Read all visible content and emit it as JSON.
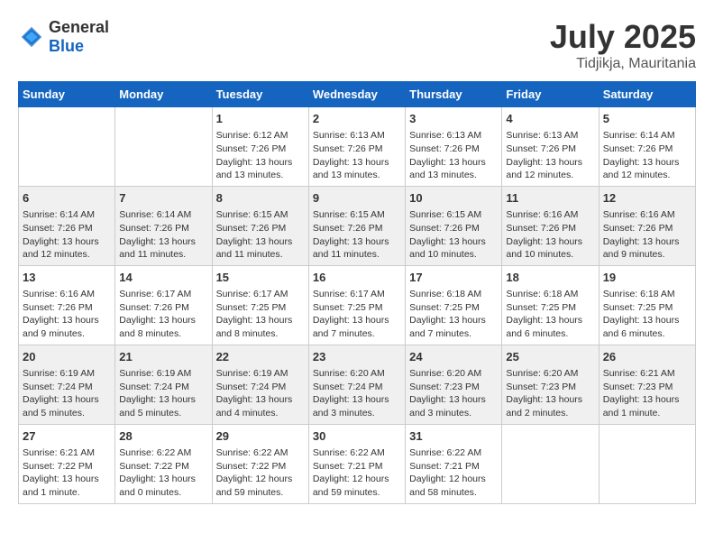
{
  "header": {
    "logo_general": "General",
    "logo_blue": "Blue",
    "month_year": "July 2025",
    "location": "Tidjikja, Mauritania"
  },
  "weekdays": [
    "Sunday",
    "Monday",
    "Tuesday",
    "Wednesday",
    "Thursday",
    "Friday",
    "Saturday"
  ],
  "weeks": [
    [
      {
        "day": "",
        "sunrise": "",
        "sunset": "",
        "daylight": ""
      },
      {
        "day": "",
        "sunrise": "",
        "sunset": "",
        "daylight": ""
      },
      {
        "day": "1",
        "sunrise": "Sunrise: 6:12 AM",
        "sunset": "Sunset: 7:26 PM",
        "daylight": "Daylight: 13 hours and 13 minutes."
      },
      {
        "day": "2",
        "sunrise": "Sunrise: 6:13 AM",
        "sunset": "Sunset: 7:26 PM",
        "daylight": "Daylight: 13 hours and 13 minutes."
      },
      {
        "day": "3",
        "sunrise": "Sunrise: 6:13 AM",
        "sunset": "Sunset: 7:26 PM",
        "daylight": "Daylight: 13 hours and 13 minutes."
      },
      {
        "day": "4",
        "sunrise": "Sunrise: 6:13 AM",
        "sunset": "Sunset: 7:26 PM",
        "daylight": "Daylight: 13 hours and 12 minutes."
      },
      {
        "day": "5",
        "sunrise": "Sunrise: 6:14 AM",
        "sunset": "Sunset: 7:26 PM",
        "daylight": "Daylight: 13 hours and 12 minutes."
      }
    ],
    [
      {
        "day": "6",
        "sunrise": "Sunrise: 6:14 AM",
        "sunset": "Sunset: 7:26 PM",
        "daylight": "Daylight: 13 hours and 12 minutes."
      },
      {
        "day": "7",
        "sunrise": "Sunrise: 6:14 AM",
        "sunset": "Sunset: 7:26 PM",
        "daylight": "Daylight: 13 hours and 11 minutes."
      },
      {
        "day": "8",
        "sunrise": "Sunrise: 6:15 AM",
        "sunset": "Sunset: 7:26 PM",
        "daylight": "Daylight: 13 hours and 11 minutes."
      },
      {
        "day": "9",
        "sunrise": "Sunrise: 6:15 AM",
        "sunset": "Sunset: 7:26 PM",
        "daylight": "Daylight: 13 hours and 11 minutes."
      },
      {
        "day": "10",
        "sunrise": "Sunrise: 6:15 AM",
        "sunset": "Sunset: 7:26 PM",
        "daylight": "Daylight: 13 hours and 10 minutes."
      },
      {
        "day": "11",
        "sunrise": "Sunrise: 6:16 AM",
        "sunset": "Sunset: 7:26 PM",
        "daylight": "Daylight: 13 hours and 10 minutes."
      },
      {
        "day": "12",
        "sunrise": "Sunrise: 6:16 AM",
        "sunset": "Sunset: 7:26 PM",
        "daylight": "Daylight: 13 hours and 9 minutes."
      }
    ],
    [
      {
        "day": "13",
        "sunrise": "Sunrise: 6:16 AM",
        "sunset": "Sunset: 7:26 PM",
        "daylight": "Daylight: 13 hours and 9 minutes."
      },
      {
        "day": "14",
        "sunrise": "Sunrise: 6:17 AM",
        "sunset": "Sunset: 7:26 PM",
        "daylight": "Daylight: 13 hours and 8 minutes."
      },
      {
        "day": "15",
        "sunrise": "Sunrise: 6:17 AM",
        "sunset": "Sunset: 7:25 PM",
        "daylight": "Daylight: 13 hours and 8 minutes."
      },
      {
        "day": "16",
        "sunrise": "Sunrise: 6:17 AM",
        "sunset": "Sunset: 7:25 PM",
        "daylight": "Daylight: 13 hours and 7 minutes."
      },
      {
        "day": "17",
        "sunrise": "Sunrise: 6:18 AM",
        "sunset": "Sunset: 7:25 PM",
        "daylight": "Daylight: 13 hours and 7 minutes."
      },
      {
        "day": "18",
        "sunrise": "Sunrise: 6:18 AM",
        "sunset": "Sunset: 7:25 PM",
        "daylight": "Daylight: 13 hours and 6 minutes."
      },
      {
        "day": "19",
        "sunrise": "Sunrise: 6:18 AM",
        "sunset": "Sunset: 7:25 PM",
        "daylight": "Daylight: 13 hours and 6 minutes."
      }
    ],
    [
      {
        "day": "20",
        "sunrise": "Sunrise: 6:19 AM",
        "sunset": "Sunset: 7:24 PM",
        "daylight": "Daylight: 13 hours and 5 minutes."
      },
      {
        "day": "21",
        "sunrise": "Sunrise: 6:19 AM",
        "sunset": "Sunset: 7:24 PM",
        "daylight": "Daylight: 13 hours and 5 minutes."
      },
      {
        "day": "22",
        "sunrise": "Sunrise: 6:19 AM",
        "sunset": "Sunset: 7:24 PM",
        "daylight": "Daylight: 13 hours and 4 minutes."
      },
      {
        "day": "23",
        "sunrise": "Sunrise: 6:20 AM",
        "sunset": "Sunset: 7:24 PM",
        "daylight": "Daylight: 13 hours and 3 minutes."
      },
      {
        "day": "24",
        "sunrise": "Sunrise: 6:20 AM",
        "sunset": "Sunset: 7:23 PM",
        "daylight": "Daylight: 13 hours and 3 minutes."
      },
      {
        "day": "25",
        "sunrise": "Sunrise: 6:20 AM",
        "sunset": "Sunset: 7:23 PM",
        "daylight": "Daylight: 13 hours and 2 minutes."
      },
      {
        "day": "26",
        "sunrise": "Sunrise: 6:21 AM",
        "sunset": "Sunset: 7:23 PM",
        "daylight": "Daylight: 13 hours and 1 minute."
      }
    ],
    [
      {
        "day": "27",
        "sunrise": "Sunrise: 6:21 AM",
        "sunset": "Sunset: 7:22 PM",
        "daylight": "Daylight: 13 hours and 1 minute."
      },
      {
        "day": "28",
        "sunrise": "Sunrise: 6:22 AM",
        "sunset": "Sunset: 7:22 PM",
        "daylight": "Daylight: 13 hours and 0 minutes."
      },
      {
        "day": "29",
        "sunrise": "Sunrise: 6:22 AM",
        "sunset": "Sunset: 7:22 PM",
        "daylight": "Daylight: 12 hours and 59 minutes."
      },
      {
        "day": "30",
        "sunrise": "Sunrise: 6:22 AM",
        "sunset": "Sunset: 7:21 PM",
        "daylight": "Daylight: 12 hours and 59 minutes."
      },
      {
        "day": "31",
        "sunrise": "Sunrise: 6:22 AM",
        "sunset": "Sunset: 7:21 PM",
        "daylight": "Daylight: 12 hours and 58 minutes."
      },
      {
        "day": "",
        "sunrise": "",
        "sunset": "",
        "daylight": ""
      },
      {
        "day": "",
        "sunrise": "",
        "sunset": "",
        "daylight": ""
      }
    ]
  ]
}
